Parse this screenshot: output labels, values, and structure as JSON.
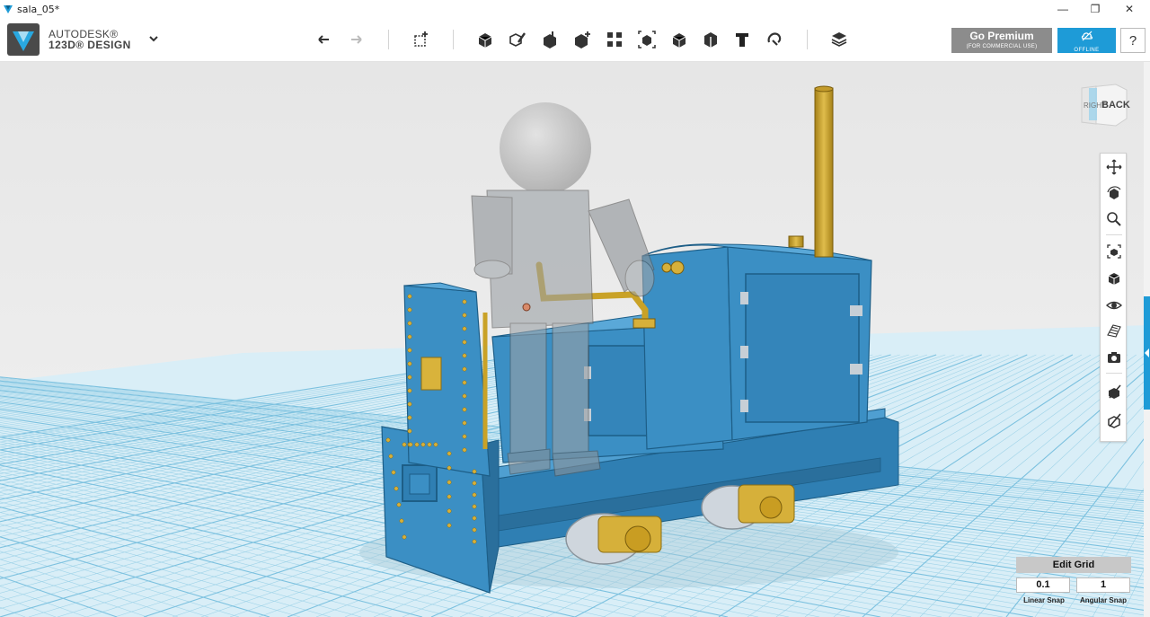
{
  "window": {
    "title": "sala_05*",
    "controls": {
      "minimize": "—",
      "maximize": "❐",
      "close": "✕"
    }
  },
  "brand": {
    "line1": "AUTODESK®",
    "line2": "123D® DESIGN"
  },
  "toolbar": {
    "tools": [
      "undo-icon",
      "redo-icon",
      "transform-icon",
      "primitives-icon",
      "sketch-icon",
      "construct-icon",
      "modify-icon",
      "pattern-icon",
      "grouping-icon",
      "combine-icon",
      "measure-icon",
      "text-icon",
      "snap-icon",
      "material-icon"
    ]
  },
  "premium": {
    "label": "Go Premium",
    "sublabel": "(FOR COMMERCIAL USE)"
  },
  "offline": {
    "label": "OFFLINE"
  },
  "help": {
    "label": "?"
  },
  "viewcube": {
    "face": "BACK",
    "side": "RIGHT"
  },
  "navbar": {
    "tools": [
      "pan-icon",
      "orbit-icon",
      "zoom-icon",
      "fit-icon",
      "views-icon",
      "visibility-icon",
      "grid-icon",
      "camera-icon",
      "material-toggle-icon",
      "outline-toggle-icon"
    ]
  },
  "grid": {
    "edit_label": "Edit Grid",
    "linear_snap_value": "0.1",
    "angular_snap_value": "1",
    "linear_snap_label": "Linear Snap",
    "angular_snap_label": "Angular Snap"
  },
  "colors": {
    "accent": "#1e9bd7",
    "model_body": "#3b8fc4",
    "brass": "#c9a227",
    "grid_line": "#9fd3e8",
    "premium_bg": "#8c8c8c"
  }
}
